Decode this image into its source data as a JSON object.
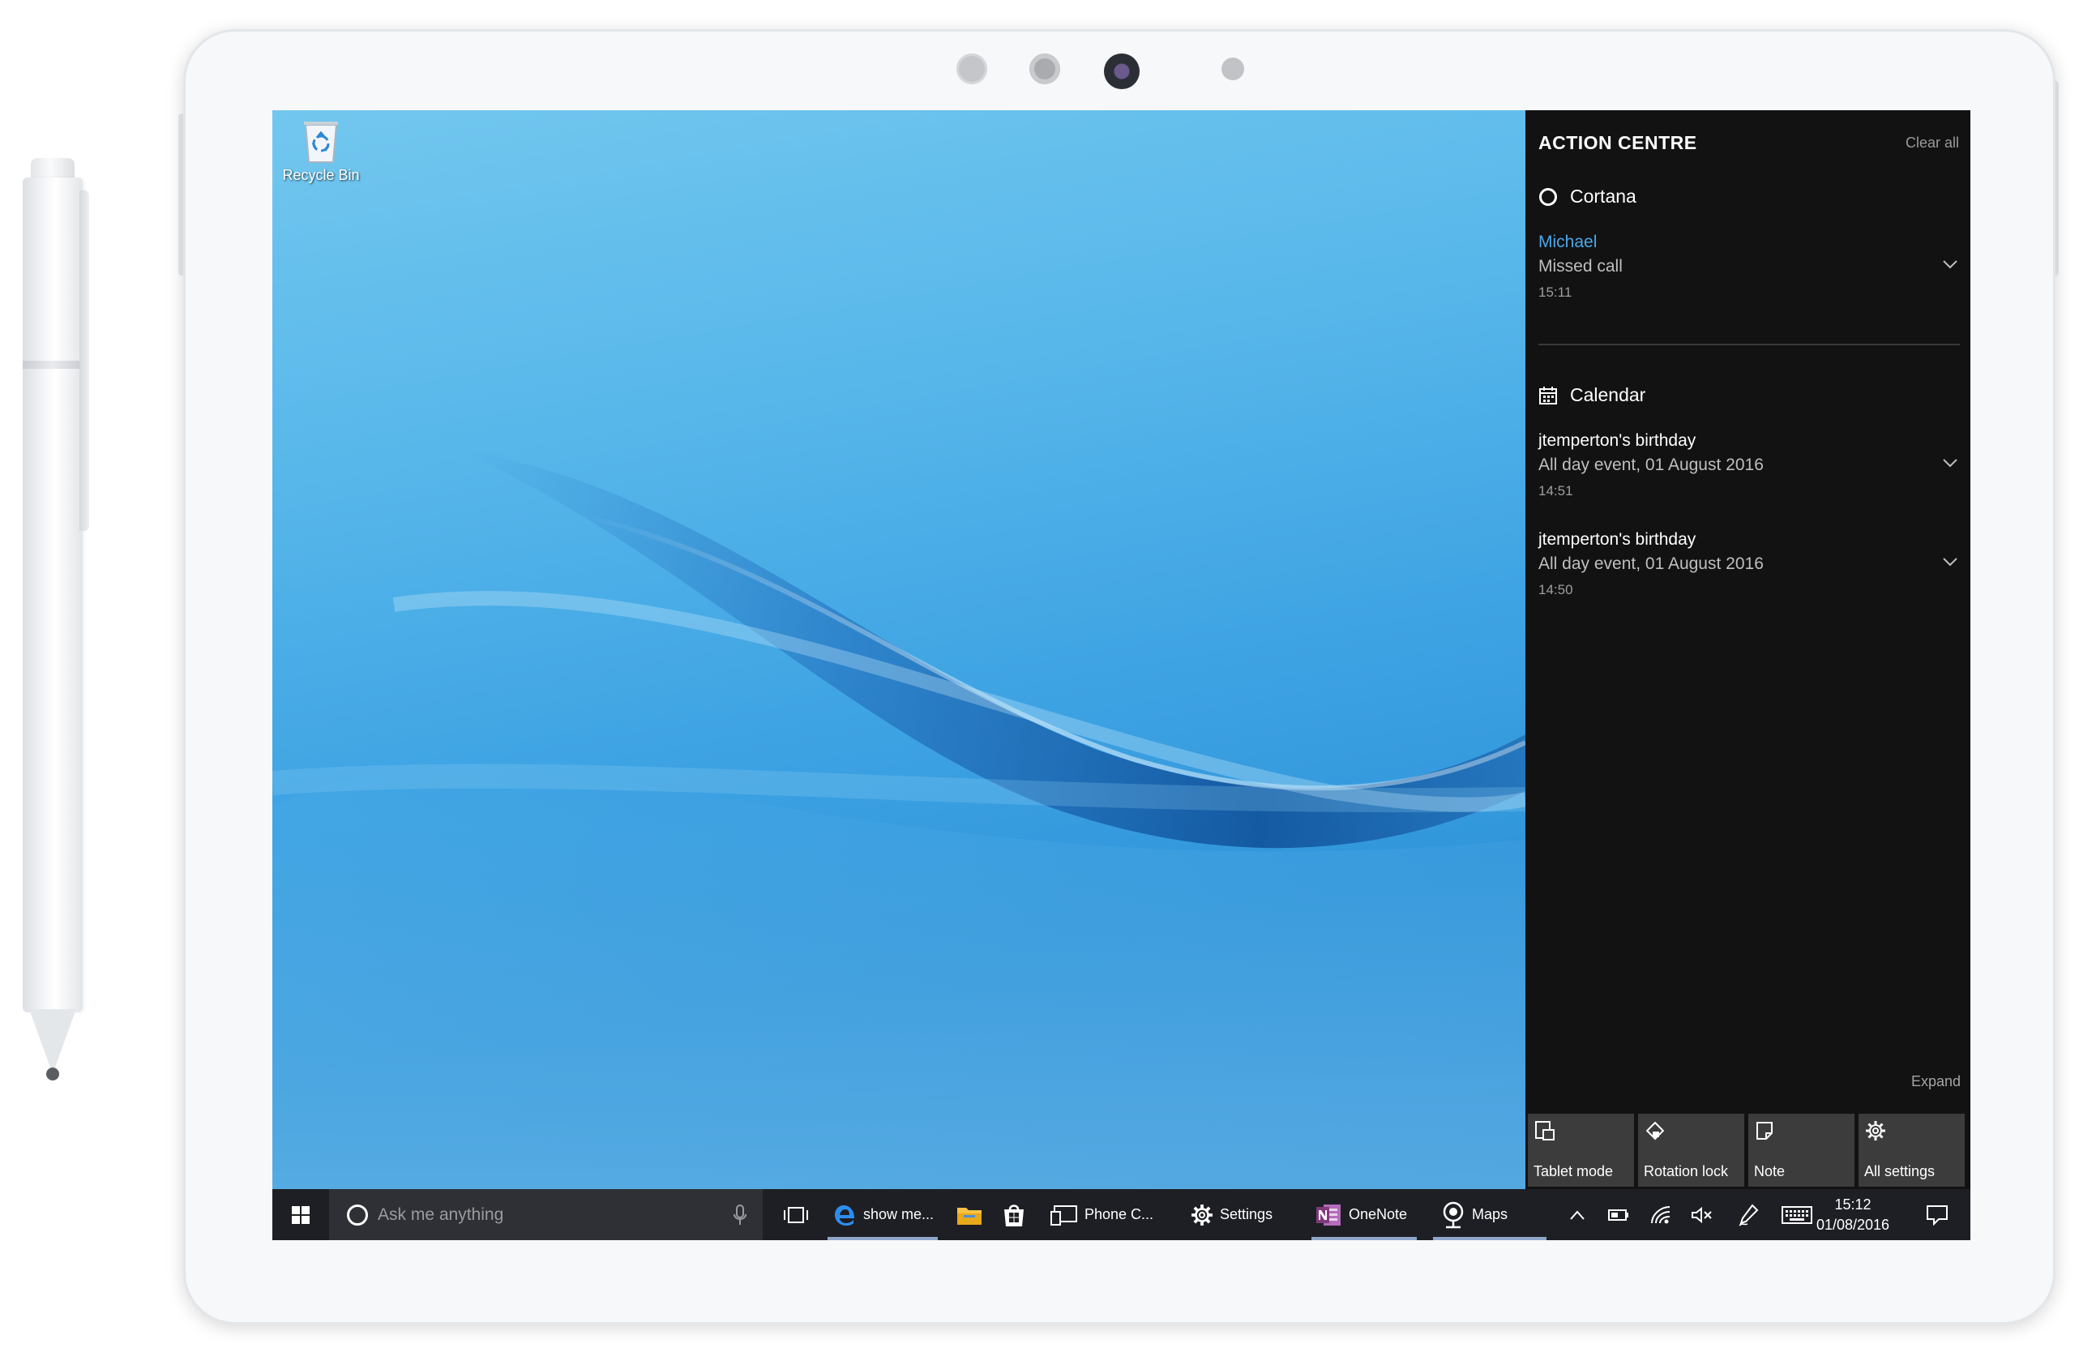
{
  "desktop": {
    "icons": [
      {
        "label": "Recycle Bin",
        "icon": "recycle-bin-icon"
      }
    ],
    "wallpaper": "blue-wave",
    "colors": {
      "sky_top": "#72c7ee",
      "sky_bottom": "#2f8ed6"
    }
  },
  "action_centre": {
    "title": "ACTION CENTRE",
    "clear_all": "Clear all",
    "groups": [
      {
        "app": "Cortana",
        "icon": "cortana-ring-icon",
        "notifications": [
          {
            "title": "Michael",
            "body": "Missed call",
            "time": "15:11"
          }
        ]
      },
      {
        "app": "Calendar",
        "icon": "calendar-icon",
        "notifications": [
          {
            "title": "jtemperton's birthday",
            "body": "All day event, 01 August 2016",
            "time": "14:51"
          },
          {
            "title": "jtemperton's birthday",
            "body": "All day event, 01 August 2016",
            "time": "14:50"
          }
        ]
      }
    ],
    "expand": "Expand",
    "quick_actions": [
      {
        "label": "Tablet mode",
        "icon": "tablet-mode-icon"
      },
      {
        "label": "Rotation lock",
        "icon": "rotation-lock-icon"
      },
      {
        "label": "Note",
        "icon": "note-icon"
      },
      {
        "label": "All settings",
        "icon": "gear-icon"
      }
    ],
    "colors": {
      "background": "#121212",
      "accent": "#4aa8ec",
      "tile": "#3c3c3c"
    }
  },
  "taskbar": {
    "search_placeholder": "Ask me anything",
    "apps": [
      {
        "label": "show me...",
        "icon": "edge-icon",
        "running": true
      },
      {
        "label": "",
        "icon": "file-explorer-icon",
        "running": false
      },
      {
        "label": "",
        "icon": "store-icon",
        "running": false
      },
      {
        "label": "Phone C...",
        "icon": "phone-companion-icon",
        "running": false
      },
      {
        "label": "Settings",
        "icon": "gear-icon",
        "running": false
      },
      {
        "label": "OneNote",
        "icon": "onenote-icon",
        "running": true
      },
      {
        "label": "Maps",
        "icon": "maps-icon",
        "running": true
      }
    ],
    "tray_icons": [
      "chevron-up-icon",
      "battery-icon",
      "wifi-icon",
      "volume-mute-icon",
      "pen-icon",
      "keyboard-icon"
    ],
    "clock": {
      "time": "15:12",
      "date": "01/08/2016"
    },
    "colors": {
      "background": "#1e1f24",
      "search_bg": "#2e3035"
    }
  }
}
